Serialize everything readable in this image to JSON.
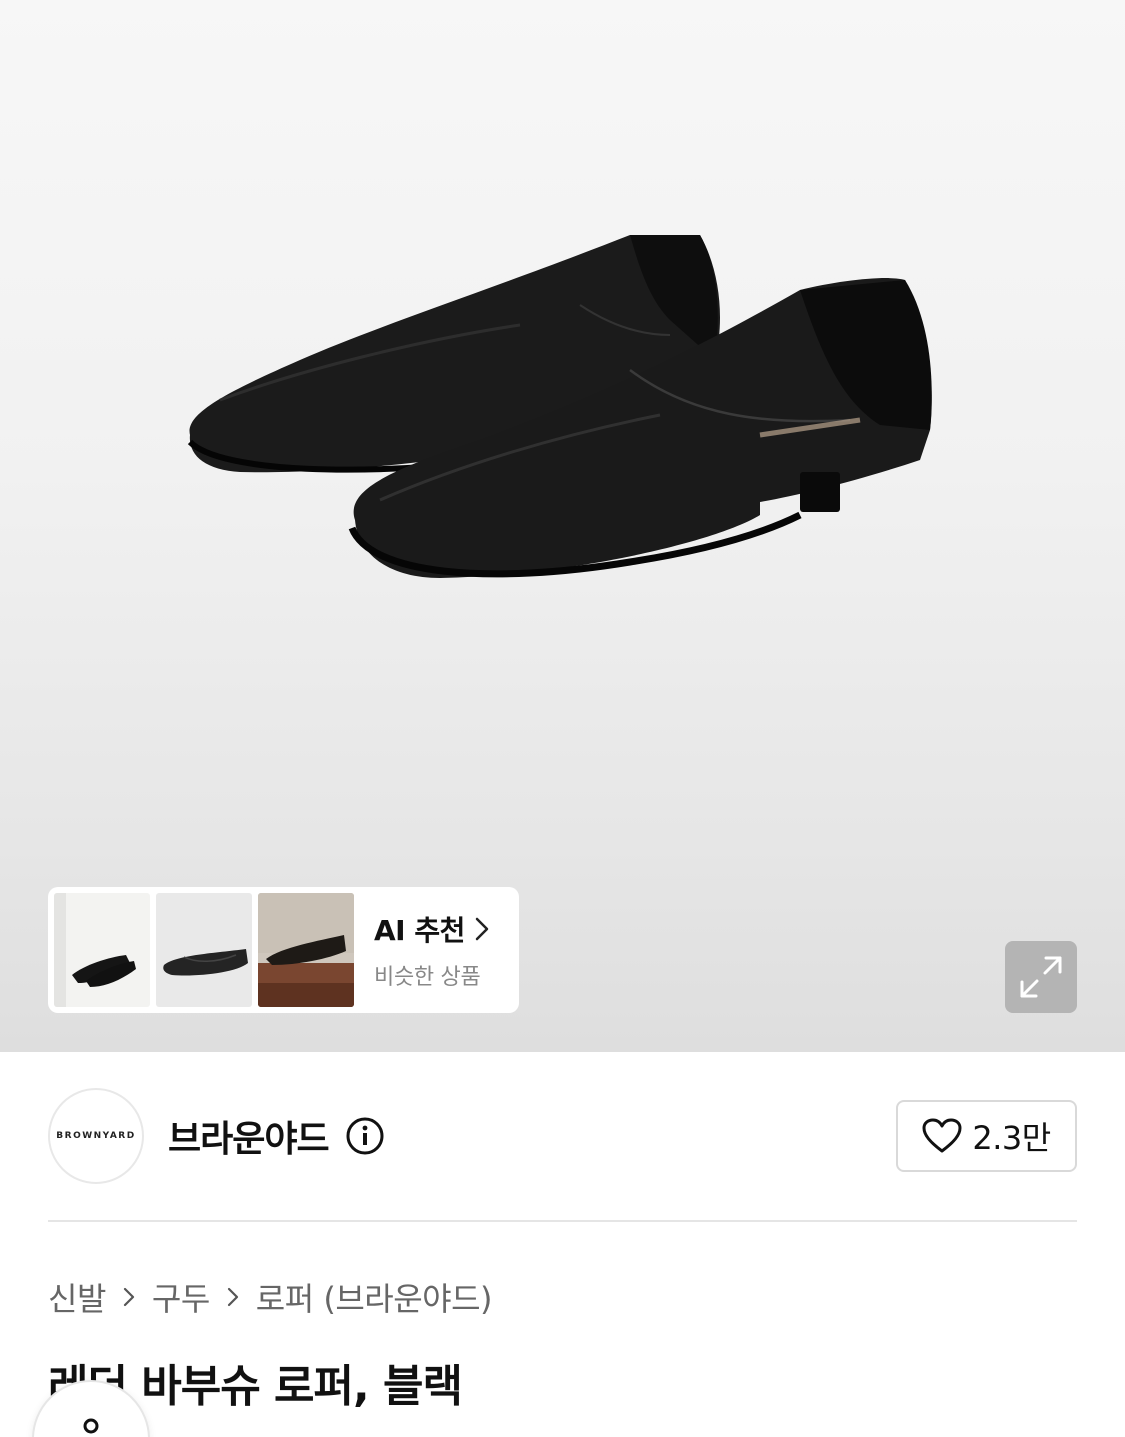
{
  "gallery": {
    "ai_recommend": {
      "title": "AI 추천",
      "subtitle": "비슷한 상품"
    },
    "thumbnails": [
      "thumbnail-1",
      "thumbnail-2",
      "thumbnail-3"
    ]
  },
  "brand": {
    "logo_text": "BROWNYARD",
    "name": "브라운야드",
    "like_count": "2.3만"
  },
  "breadcrumb": {
    "items": [
      "신발",
      "구두",
      "로퍼 (브라운야드)"
    ]
  },
  "product": {
    "title": "레더 바부슈 로퍼, 블랙"
  },
  "colors": {
    "text_primary": "#111111",
    "text_secondary": "#666666",
    "border": "#d9d9d9"
  }
}
